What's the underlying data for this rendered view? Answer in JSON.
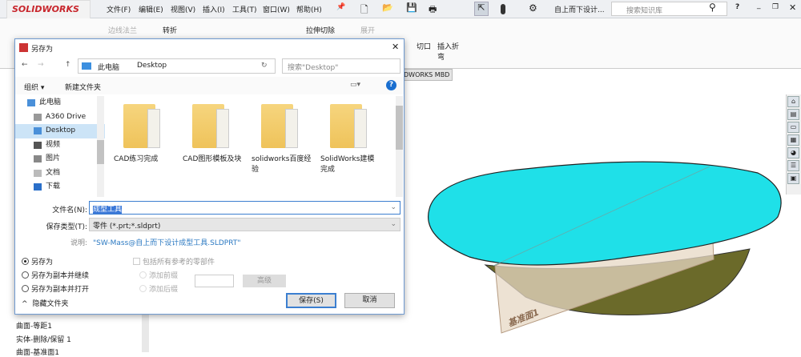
{
  "app": {
    "logo": "SOLIDWORKS",
    "doc_title": "自上而下设计...",
    "search_placeholder": "搜索知识库"
  },
  "menu": [
    "文件(F)",
    "编辑(E)",
    "视图(V)",
    "插入(I)",
    "工具(T)",
    "窗口(W)",
    "帮助(H)"
  ],
  "commands": {
    "edge_flange": "边线法兰",
    "jog": "转折",
    "extrude_cut": "拉伸切除",
    "unfold": "展开",
    "cut": "切口",
    "insert_bend": "插入折弯"
  },
  "graphics": {
    "tab": "DWORKS MBD",
    "plane_label": "基准面1",
    "colors": {
      "surface": "#1fe0e8",
      "body": "#6b6a2a",
      "plane": "#e7d8c4"
    }
  },
  "tree": {
    "items": [
      "曲面-等距1",
      "实体-删除/保留 1",
      "曲面-基准面1"
    ]
  },
  "dialog": {
    "title": "另存为",
    "breadcrumb": [
      "此电脑",
      "Desktop"
    ],
    "search_placeholder": "搜索\"Desktop\"",
    "organize": "组织 ▾",
    "new_folder": "新建文件夹",
    "nav": [
      "此电脑",
      "A360 Drive",
      "Desktop",
      "视频",
      "图片",
      "文档",
      "下载"
    ],
    "files": [
      "CAD练习完成",
      "CAD图形模板及块",
      "solidworks百度经验",
      "SolidWorks建模完成"
    ],
    "filename_label": "文件名(N):",
    "filename": "成型工具",
    "type_label": "保存类型(T):",
    "type": "零件 (*.prt;*.sldprt)",
    "desc_label": "说明:",
    "desc": "\"SW-Mass@自上而下设计成型工具.SLDPRT\"",
    "opt_save_as": "另存为",
    "opt_copy_continue": "另存为副本并继续",
    "opt_copy_open": "另存为副本并打开",
    "include_refs": "包括所有参考的零部件",
    "add_prefix": "添加前缀",
    "add_suffix": "添加后缀",
    "advanced": "高级",
    "hide_folders": "隐藏文件夹",
    "save": "保存(S)",
    "cancel": "取消"
  }
}
